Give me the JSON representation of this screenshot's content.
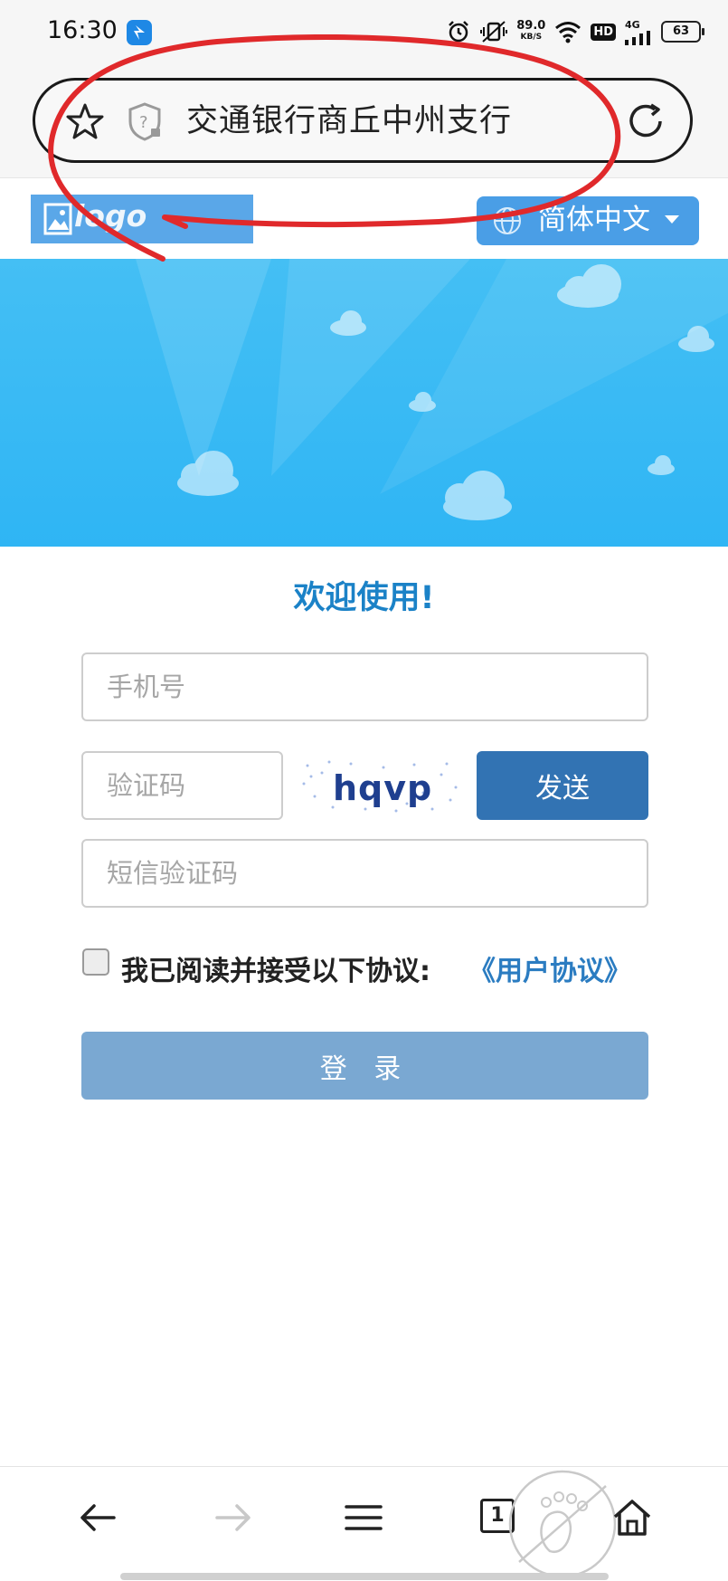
{
  "status_bar": {
    "time": "16:30",
    "net_speed_value": "89.0",
    "net_speed_unit": "KB/S",
    "hd_label": "HD",
    "network_label": "4G",
    "battery": "63"
  },
  "browser": {
    "page_title": "交通银行商丘中州支行"
  },
  "header": {
    "logo_text": "logo",
    "language": "简体中文"
  },
  "form": {
    "welcome": "欢迎使用!",
    "phone_placeholder": "手机号",
    "code_placeholder": "验证码",
    "captcha_text": "hqvp",
    "send_label": "发送",
    "sms_placeholder": "短信验证码",
    "agree_text": "我已阅读并接受以下协议:",
    "agreement_link": "《用户协议》",
    "login_label": "登 录"
  },
  "bottom_nav": {
    "tab_count": "1"
  },
  "colors": {
    "accent": "#3273b3",
    "link": "#2b7cc1",
    "banner": "#34b8f4",
    "login_disabled": "#7aa8d2",
    "annotation_red": "#e0292b"
  }
}
